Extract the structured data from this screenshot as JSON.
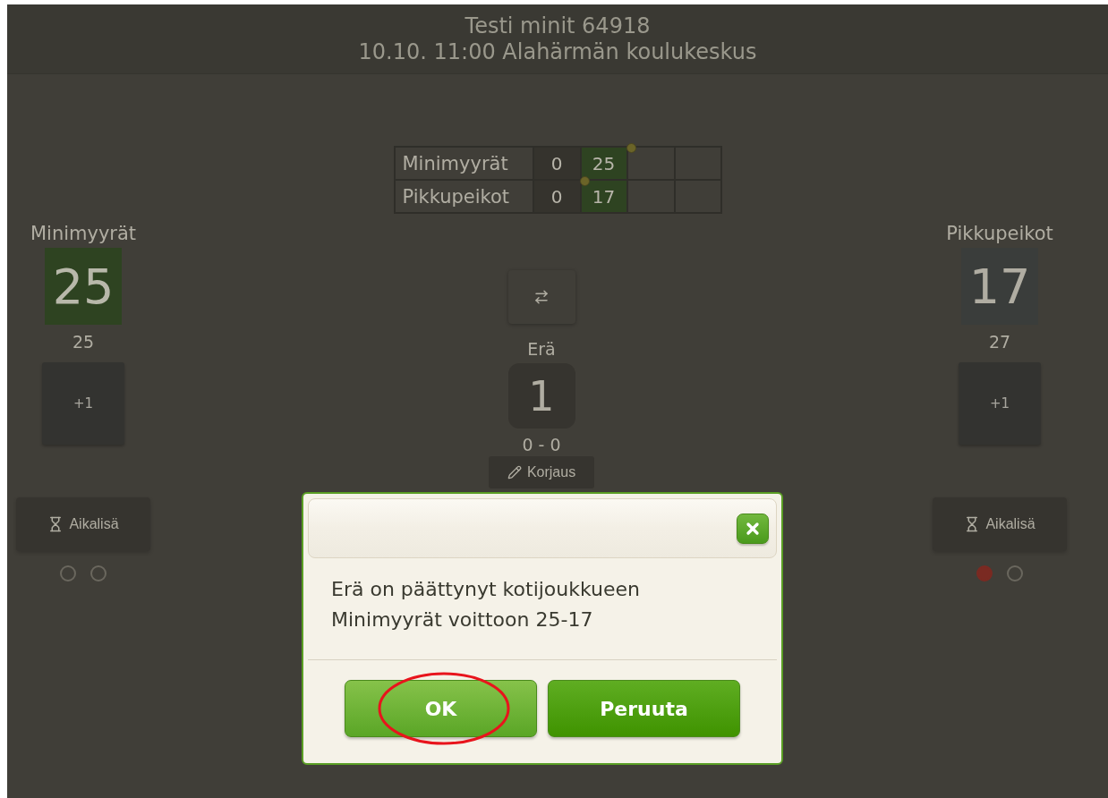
{
  "header": {
    "title": "Testi minit 64918",
    "subtitle": "10.10. 11:00 Alahärmän koulukeskus"
  },
  "scoreboard": {
    "rows": [
      {
        "team": "Minimyyrät",
        "serve_marker": true,
        "sets": [
          {
            "value": "0",
            "current": false
          },
          {
            "value": "25",
            "current": true
          }
        ]
      },
      {
        "team": "Pikkupeikot",
        "serve_marker": true,
        "sets": [
          {
            "value": "0",
            "current": false
          },
          {
            "value": "17",
            "current": true
          }
        ]
      }
    ]
  },
  "teams": [
    {
      "name": "Minimyyrät",
      "score": "25",
      "leading": true,
      "total": "25",
      "add_button": "+1",
      "timeout_button": "Aikalisä",
      "timeouts": [
        {
          "used": false
        },
        {
          "used": false
        }
      ]
    },
    {
      "name": "Pikkupeikot",
      "score": "17",
      "leading": false,
      "total": "27",
      "add_button": "+1",
      "timeout_button": "Aikalisä",
      "timeouts": [
        {
          "used": true
        },
        {
          "used": false
        }
      ]
    }
  ],
  "center": {
    "set_label": "Erä",
    "set_number": "1",
    "set_score": "0 - 0",
    "fix_button": "Korjaus"
  },
  "dialog": {
    "message": "Erä on päättynyt kotijoukkueen Minimyyrät voittoon 25-17",
    "buttons": [
      {
        "label": "OK",
        "kind": "confirm",
        "highlighted": true
      },
      {
        "label": "Peruuta",
        "kind": "cancel",
        "highlighted": false
      }
    ]
  }
}
